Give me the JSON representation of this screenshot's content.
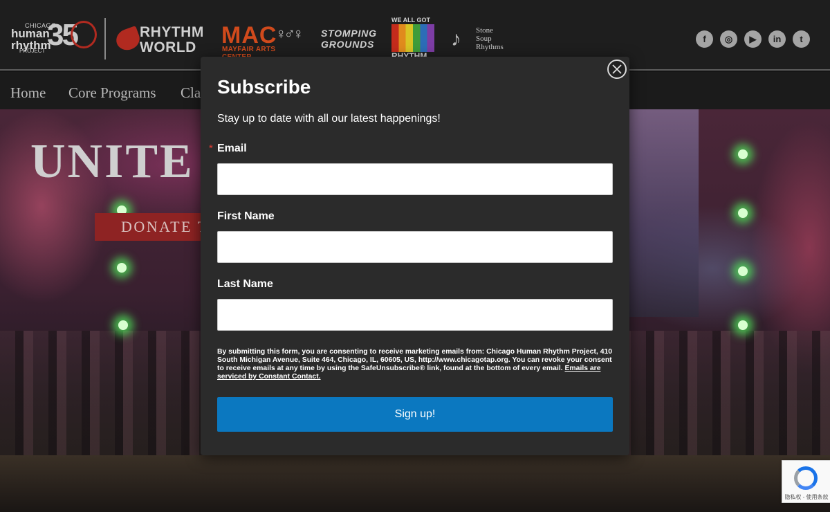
{
  "header": {
    "logos": {
      "chrp": {
        "line1": "CHICAGO",
        "line2": "human",
        "line3": "rhythm",
        "line4": "PROJECT",
        "number": "35"
      },
      "rhythm_world": {
        "line1": "RHYTHM",
        "line2": "WORLD"
      },
      "mac": {
        "big": "MAC",
        "sub_a": "MAYFAIR",
        "sub_b": "ARTS CENTER"
      },
      "stomping_grounds": {
        "line1": "STOMPING",
        "line2": "GROUNDS"
      },
      "we_all_got": {
        "top": "WE ALL GOT",
        "bottom": "RHYTHM"
      },
      "stone_soup": {
        "line1": "Stone",
        "line2": "Soup",
        "line3": "Rhythms"
      }
    },
    "social": [
      {
        "icon": "facebook-icon",
        "glyph": "f"
      },
      {
        "icon": "instagram-icon",
        "glyph": "◎"
      },
      {
        "icon": "youtube-icon",
        "glyph": "▶"
      },
      {
        "icon": "linkedin-icon",
        "glyph": "in"
      },
      {
        "icon": "twitter-icon",
        "glyph": "t"
      }
    ]
  },
  "nav": {
    "items": [
      "Home",
      "Core Programs",
      "Cla"
    ]
  },
  "hero": {
    "title": "UNITE",
    "donate_label": "DONATE T"
  },
  "modal": {
    "title": "Subscribe",
    "subtitle": "Stay up to date with all our latest happenings!",
    "required_marker": "*",
    "fields": [
      {
        "label": "Email",
        "value": "",
        "placeholder": ""
      },
      {
        "label": "First Name",
        "value": "",
        "placeholder": ""
      },
      {
        "label": "Last Name",
        "value": "",
        "placeholder": ""
      }
    ],
    "consent_text": "By submitting this form, you are consenting to receive marketing emails from: Chicago Human Rhythm Project, 410 South Michigan Avenue, Suite 464, Chicago, IL, 60605, US, http://www.chicagotap.org. You can revoke your consent to receive emails at any time by using the SafeUnsubscribe® link, found at the bottom of every email. ",
    "consent_link": "Emails are serviced by Constant Contact.",
    "submit_label": "Sign up!"
  },
  "recaptcha": {
    "text": "隐私权 - 使用条款"
  },
  "colors": {
    "accent_button": "#0b78c0",
    "required": "#e23c32",
    "modal_bg": "#2b2b2b",
    "donate_bg": "#8e2323"
  }
}
